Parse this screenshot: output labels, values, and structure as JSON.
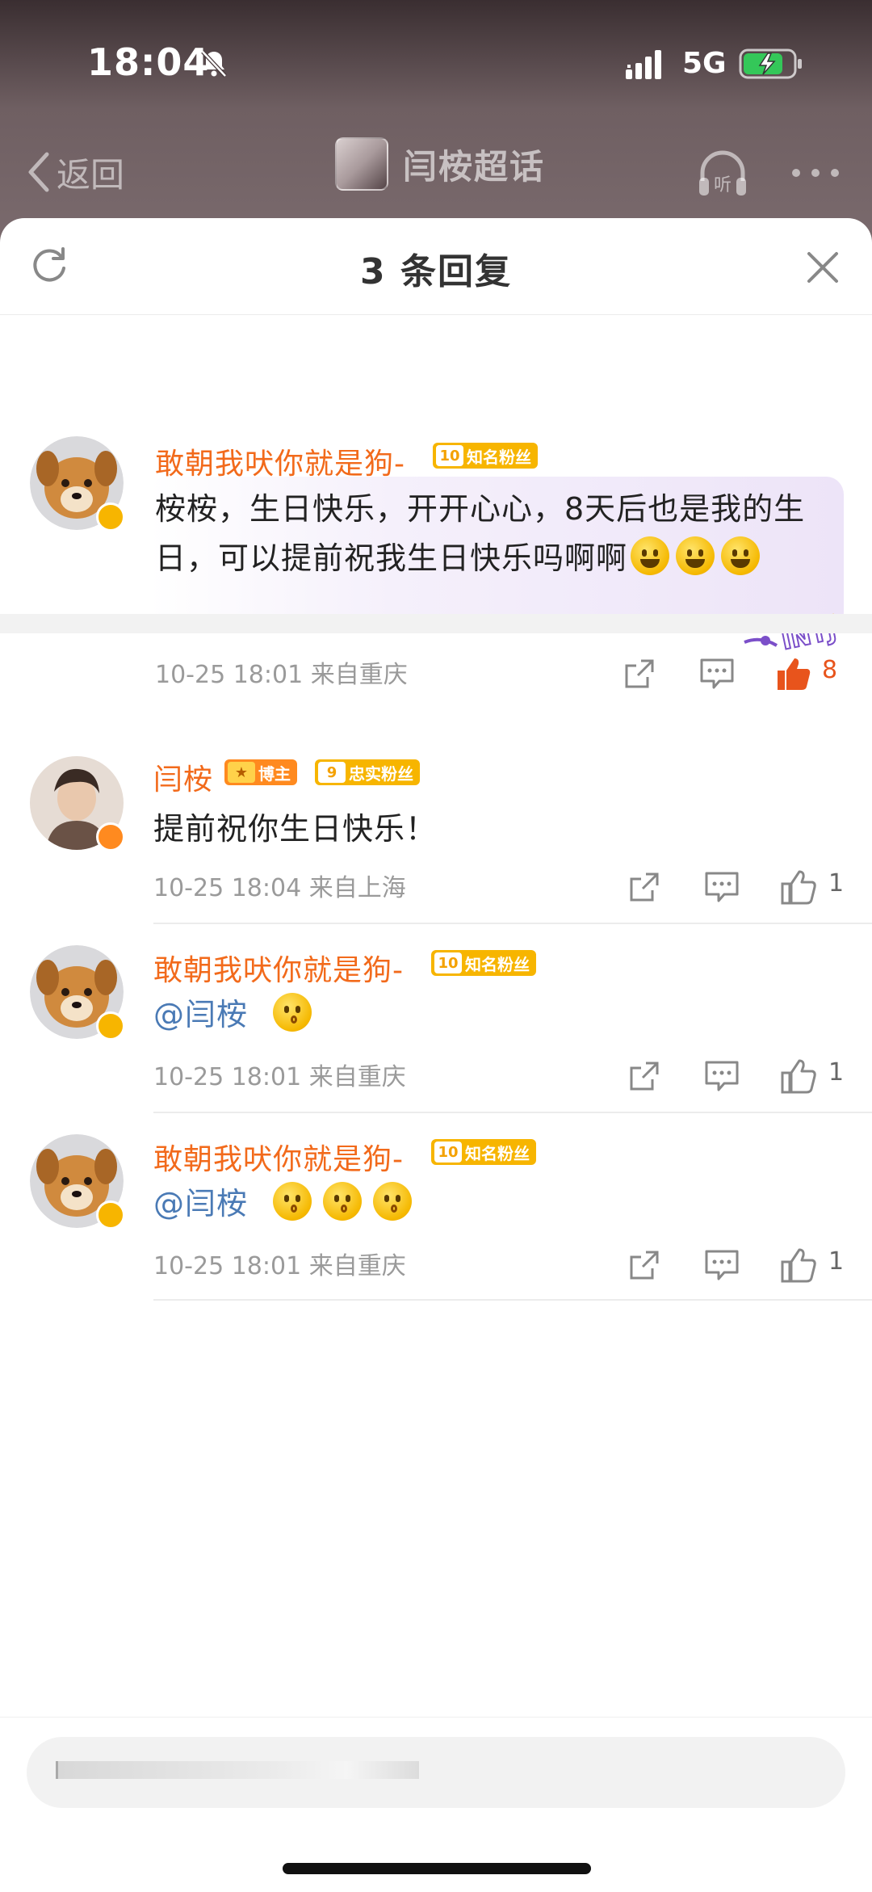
{
  "status_bar": {
    "time": "18:04",
    "network": "5G",
    "battery_color": "#34c759"
  },
  "nav": {
    "back_label": "返回",
    "topic_name": "闫桉超话"
  },
  "sheet": {
    "title": "3 条回复"
  },
  "main_comment": {
    "username": "敢朝我吠你就是狗-",
    "badge_level": "10",
    "badge_label": "知名粉丝",
    "text": "桉桉，生日快乐，开开心心，8天后也是我的生日，可以提前祝我生日快乐吗啊啊",
    "meta": "10-25 18:01  来自重庆",
    "likes": "8",
    "sticker_text": "INTJ"
  },
  "replies": [
    {
      "username": "闫桉",
      "role_badge": "博主",
      "badge_level": "9",
      "badge_label": "忠实粉丝",
      "text": "提前祝你生日快乐！",
      "meta": "10-25 18:04  来自上海",
      "likes": "1"
    },
    {
      "username": "敢朝我吠你就是狗-",
      "badge_level": "10",
      "badge_label": "知名粉丝",
      "mention": "@闫桉",
      "meta": "10-25 18:01  来自重庆",
      "likes": "1"
    },
    {
      "username": "敢朝我吠你就是狗-",
      "badge_level": "10",
      "badge_label": "知名粉丝",
      "mention": "@闫桉",
      "meta": "10-25 18:01  来自重庆",
      "likes": "1"
    }
  ],
  "colors": {
    "username": "#f26a1b",
    "mention": "#4a7ab5",
    "fan_badge": "#f7b500",
    "blogger_badge": "#ff8a1f",
    "liked": "#e8541c"
  },
  "icons": [
    "bell-off-icon",
    "signal-icon",
    "battery-charging-icon",
    "chevron-left-icon",
    "headphones-icon",
    "more-icon",
    "refresh-icon",
    "close-icon",
    "share-icon",
    "comment-icon",
    "like-icon",
    "verified-icon"
  ]
}
